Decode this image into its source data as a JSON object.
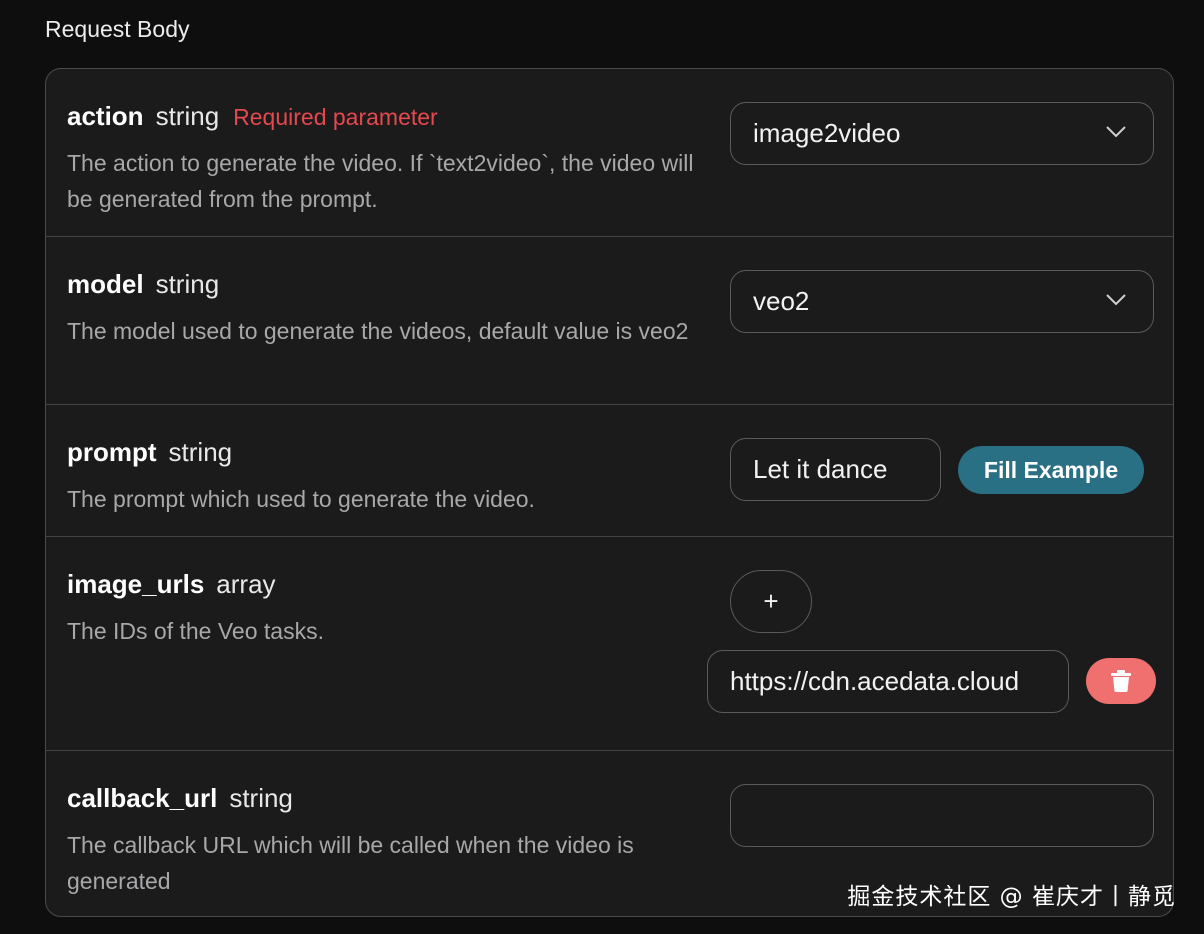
{
  "section": {
    "title": "Request Body"
  },
  "params": {
    "action": {
      "name": "action",
      "type": "string",
      "required": "Required parameter",
      "description": "The action to generate the video. If `text2video`, the video will be generated from the prompt.",
      "value": "image2video"
    },
    "model": {
      "name": "model",
      "type": "string",
      "description": "The model used to generate the videos, default value is veo2",
      "value": "veo2"
    },
    "prompt": {
      "name": "prompt",
      "type": "string",
      "description": "The prompt which used to generate the video.",
      "value": "Let it dance",
      "fill_label": "Fill Example"
    },
    "image_urls": {
      "name": "image_urls",
      "type": "array",
      "description": "The IDs of the Veo tasks.",
      "add_label": "+",
      "items": [
        "https://cdn.acedata.cloud"
      ]
    },
    "callback_url": {
      "name": "callback_url",
      "type": "string",
      "description": "The callback URL which will be called when the video is generated",
      "value": ""
    }
  },
  "icons": {
    "chevron": "chevron-down-icon",
    "delete": "trash-icon"
  },
  "colors": {
    "required": "#e5484d",
    "fill_button": "#2a7085",
    "delete_button": "#f07070"
  },
  "watermark": "掘金技术社区 @ 崔庆才丨静觅"
}
